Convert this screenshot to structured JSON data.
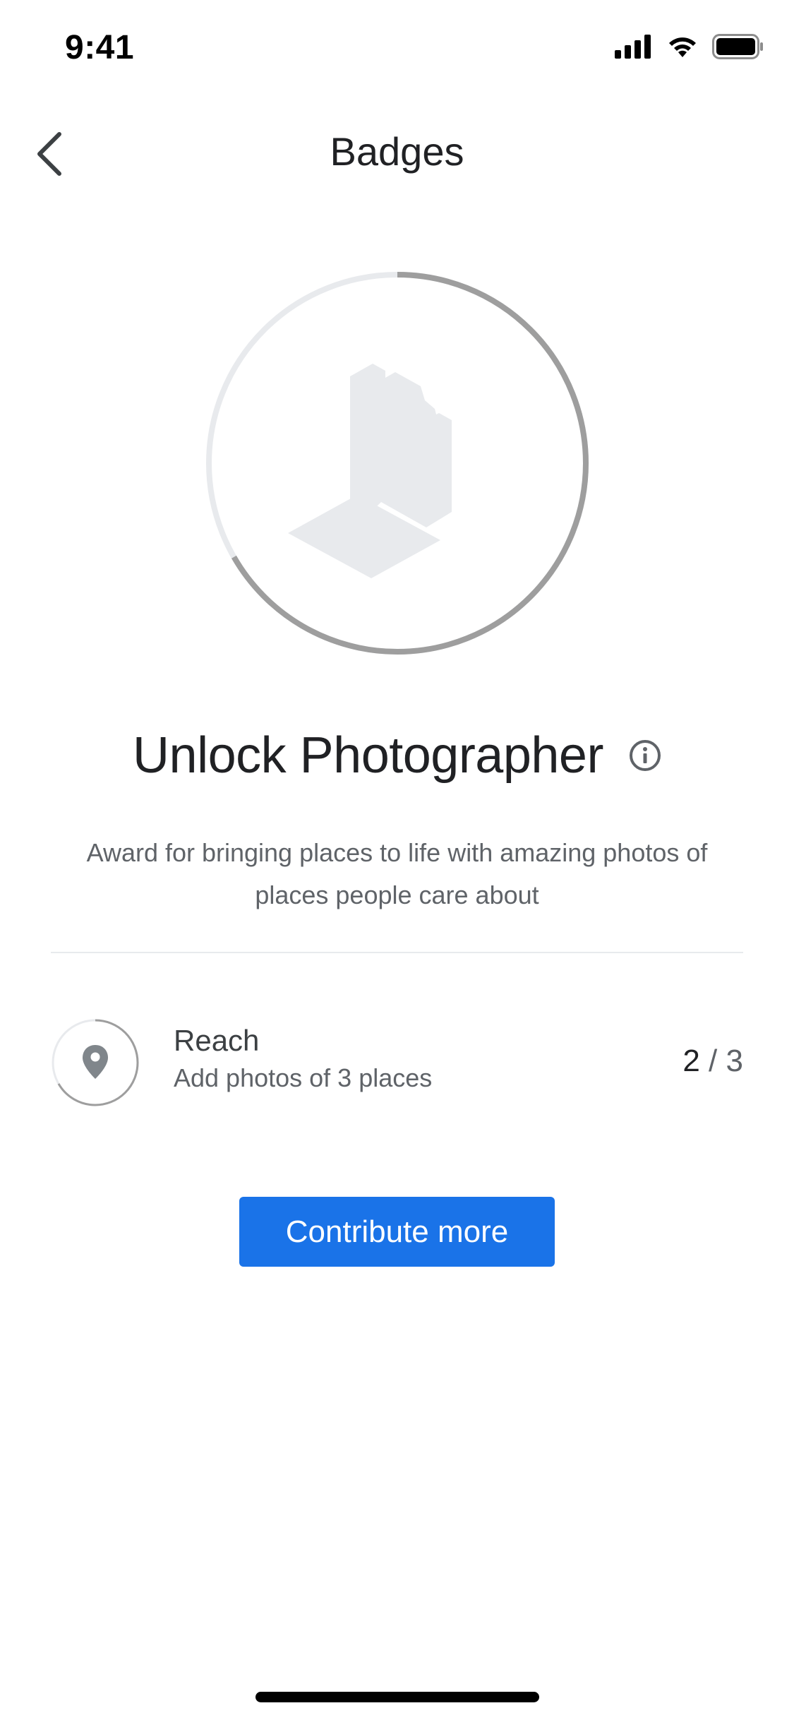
{
  "status_bar": {
    "time": "9:41"
  },
  "nav": {
    "title": "Badges",
    "back_icon": "chevron-left-icon"
  },
  "badge": {
    "title": "Unlock Photographer",
    "info_icon": "info-icon",
    "image_icon": "camera-photo-icon",
    "progress_fraction": 0.667,
    "description": "Award for bringing places to life with amazing photos of places people care about"
  },
  "task": {
    "name": "Reach",
    "subtitle": "Add photos of 3 places",
    "current": "2",
    "separator": " / ",
    "total": "3",
    "icon": "location-pin-icon"
  },
  "cta": {
    "label": "Contribute more"
  },
  "colors": {
    "accent": "#1a73e8",
    "ring_progress": "#9e9e9e",
    "ring_track": "#e8eaed"
  }
}
